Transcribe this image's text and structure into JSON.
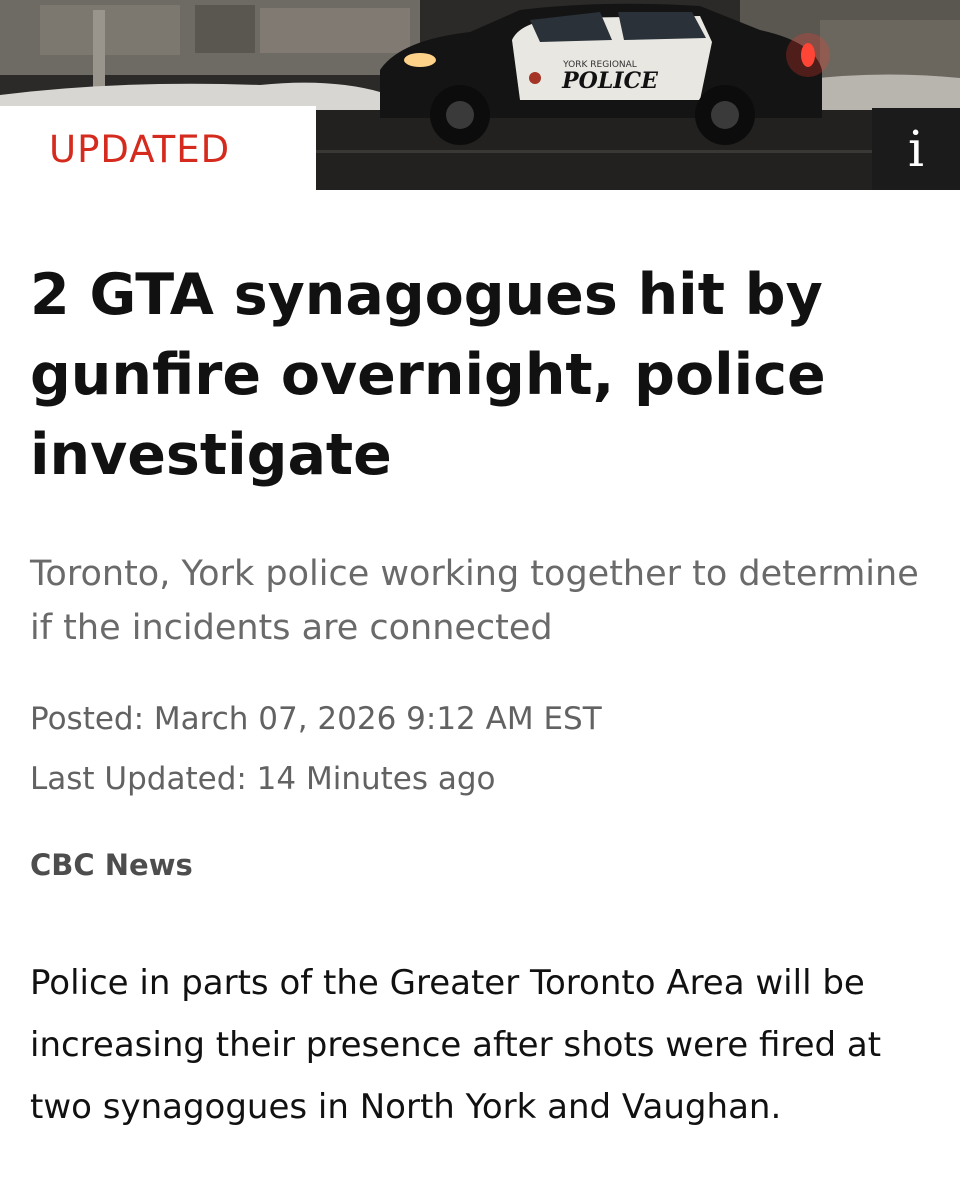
{
  "hero": {
    "badge_label": "UPDATED",
    "info_icon": "info-icon",
    "info_glyph": "i",
    "car_text_line1": "YORK REGIONAL",
    "car_text_line2": "POLICE"
  },
  "article": {
    "headline": "2 GTA synagogues hit by gunfire overnight, police investigate",
    "deck": "Toronto, York police working together to determine if the incidents are connected",
    "posted": "Posted: March 07, 2026 9:12 AM EST",
    "last_updated": "Last Updated: 14 Minutes ago",
    "source": "CBC News",
    "body": "Police in parts of the Greater Toronto Area will be increasing their presence after shots were fired at two synagogues in North York and Vaughan."
  },
  "colors": {
    "accent_red": "#d52b1e",
    "headline": "#111111",
    "deck_gray": "#6a6a6a",
    "meta_gray": "#626262"
  }
}
